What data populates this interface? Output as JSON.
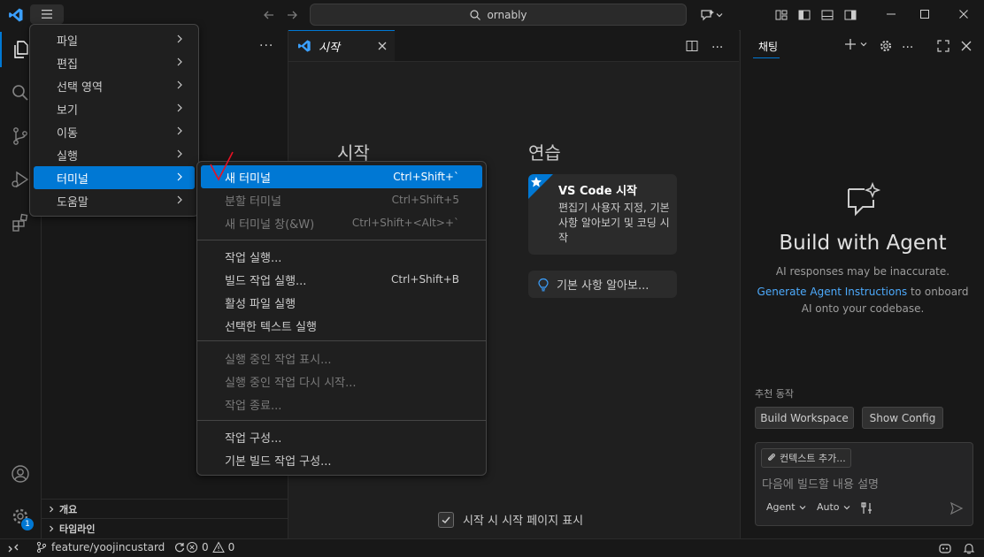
{
  "titlebar": {
    "search_text": "ornably",
    "icons": [
      "vscode-logo-icon",
      "hamburger-menu-icon",
      "back-arrow-icon",
      "forward-arrow-icon",
      "search-icon",
      "copilot-icon",
      "chevron-down-icon",
      "layout-icon",
      "toggle-primary-sidebar-icon",
      "toggle-panel-icon",
      "toggle-secondary-sidebar-icon",
      "minimize-icon",
      "maximize-icon",
      "close-icon"
    ]
  },
  "main_menu": {
    "items": [
      {
        "label": "파일"
      },
      {
        "label": "편집"
      },
      {
        "label": "선택 영역"
      },
      {
        "label": "보기"
      },
      {
        "label": "이동"
      },
      {
        "label": "실행"
      },
      {
        "label": "터미널"
      },
      {
        "label": "도움말"
      }
    ]
  },
  "terminal_menu": {
    "items": [
      {
        "label": "새 터미널",
        "shortcut": "Ctrl+Shift+`"
      },
      {
        "label": "분할 터미널",
        "shortcut": "Ctrl+Shift+5"
      },
      {
        "label": "새 터미널 창(&W)",
        "shortcut": "Ctrl+Shift+<Alt>+`"
      },
      {
        "label": "작업 실행...",
        "shortcut": ""
      },
      {
        "label": "빌드 작업 실행...",
        "shortcut": "Ctrl+Shift+B"
      },
      {
        "label": "활성 파일 실행",
        "shortcut": ""
      },
      {
        "label": "선택한 텍스트 실행",
        "shortcut": ""
      },
      {
        "label": "실행 중인 작업 표시...",
        "shortcut": ""
      },
      {
        "label": "실행 중인 작업 다시 시작...",
        "shortcut": ""
      },
      {
        "label": "작업 종료...",
        "shortcut": ""
      },
      {
        "label": "작업 구성...",
        "shortcut": ""
      },
      {
        "label": "기본 빌드 작업 구성...",
        "shortcut": ""
      }
    ]
  },
  "sidebar": {
    "more_label": "...",
    "outline_label": "개요",
    "timeline_label": "타임라인"
  },
  "editor": {
    "tab_label": "시작",
    "start_heading": "시작",
    "practice_heading": "연습",
    "walkthrough_title": "VS Code 시작",
    "walkthrough_desc": "편집기 사용자 지정, 기본 사항 알아보기 및 코딩 시작",
    "basics_label": "기본 사항 알아보...",
    "show_on_startup": "시작 시 시작 페이지 표시"
  },
  "chat": {
    "tab_label": "채팅",
    "title": "Build with Agent",
    "disclaimer": "AI responses may be inaccurate.",
    "link_text": "Generate Agent Instructions",
    "link_suffix": " to onboard",
    "link_line2": "AI onto your codebase.",
    "suggested_label": "추천 동작",
    "btn_build": "Build Workspace",
    "btn_config": "Show Config",
    "add_context": "컨텍스트 추가...",
    "placeholder": "다음에 빌드할 내용 설명",
    "mode": "Agent",
    "model": "Auto"
  },
  "statusbar": {
    "branch": "feature/yoojincustard",
    "errors": "0",
    "warnings": "0"
  },
  "accounts_badge": "1",
  "colors": {
    "accent": "#0078d4",
    "annotation": "#e81123"
  }
}
